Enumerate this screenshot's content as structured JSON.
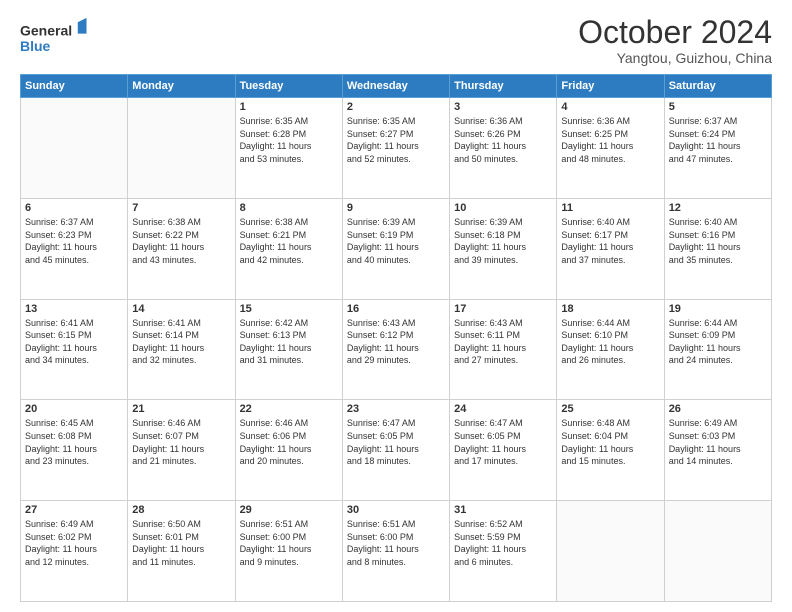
{
  "header": {
    "logo_line1": "General",
    "logo_line2": "Blue",
    "month": "October 2024",
    "location": "Yangtou, Guizhou, China"
  },
  "weekdays": [
    "Sunday",
    "Monday",
    "Tuesday",
    "Wednesday",
    "Thursday",
    "Friday",
    "Saturday"
  ],
  "weeks": [
    [
      {
        "day": "",
        "info": ""
      },
      {
        "day": "",
        "info": ""
      },
      {
        "day": "1",
        "info": "Sunrise: 6:35 AM\nSunset: 6:28 PM\nDaylight: 11 hours\nand 53 minutes."
      },
      {
        "day": "2",
        "info": "Sunrise: 6:35 AM\nSunset: 6:27 PM\nDaylight: 11 hours\nand 52 minutes."
      },
      {
        "day": "3",
        "info": "Sunrise: 6:36 AM\nSunset: 6:26 PM\nDaylight: 11 hours\nand 50 minutes."
      },
      {
        "day": "4",
        "info": "Sunrise: 6:36 AM\nSunset: 6:25 PM\nDaylight: 11 hours\nand 48 minutes."
      },
      {
        "day": "5",
        "info": "Sunrise: 6:37 AM\nSunset: 6:24 PM\nDaylight: 11 hours\nand 47 minutes."
      }
    ],
    [
      {
        "day": "6",
        "info": "Sunrise: 6:37 AM\nSunset: 6:23 PM\nDaylight: 11 hours\nand 45 minutes."
      },
      {
        "day": "7",
        "info": "Sunrise: 6:38 AM\nSunset: 6:22 PM\nDaylight: 11 hours\nand 43 minutes."
      },
      {
        "day": "8",
        "info": "Sunrise: 6:38 AM\nSunset: 6:21 PM\nDaylight: 11 hours\nand 42 minutes."
      },
      {
        "day": "9",
        "info": "Sunrise: 6:39 AM\nSunset: 6:19 PM\nDaylight: 11 hours\nand 40 minutes."
      },
      {
        "day": "10",
        "info": "Sunrise: 6:39 AM\nSunset: 6:18 PM\nDaylight: 11 hours\nand 39 minutes."
      },
      {
        "day": "11",
        "info": "Sunrise: 6:40 AM\nSunset: 6:17 PM\nDaylight: 11 hours\nand 37 minutes."
      },
      {
        "day": "12",
        "info": "Sunrise: 6:40 AM\nSunset: 6:16 PM\nDaylight: 11 hours\nand 35 minutes."
      }
    ],
    [
      {
        "day": "13",
        "info": "Sunrise: 6:41 AM\nSunset: 6:15 PM\nDaylight: 11 hours\nand 34 minutes."
      },
      {
        "day": "14",
        "info": "Sunrise: 6:41 AM\nSunset: 6:14 PM\nDaylight: 11 hours\nand 32 minutes."
      },
      {
        "day": "15",
        "info": "Sunrise: 6:42 AM\nSunset: 6:13 PM\nDaylight: 11 hours\nand 31 minutes."
      },
      {
        "day": "16",
        "info": "Sunrise: 6:43 AM\nSunset: 6:12 PM\nDaylight: 11 hours\nand 29 minutes."
      },
      {
        "day": "17",
        "info": "Sunrise: 6:43 AM\nSunset: 6:11 PM\nDaylight: 11 hours\nand 27 minutes."
      },
      {
        "day": "18",
        "info": "Sunrise: 6:44 AM\nSunset: 6:10 PM\nDaylight: 11 hours\nand 26 minutes."
      },
      {
        "day": "19",
        "info": "Sunrise: 6:44 AM\nSunset: 6:09 PM\nDaylight: 11 hours\nand 24 minutes."
      }
    ],
    [
      {
        "day": "20",
        "info": "Sunrise: 6:45 AM\nSunset: 6:08 PM\nDaylight: 11 hours\nand 23 minutes."
      },
      {
        "day": "21",
        "info": "Sunrise: 6:46 AM\nSunset: 6:07 PM\nDaylight: 11 hours\nand 21 minutes."
      },
      {
        "day": "22",
        "info": "Sunrise: 6:46 AM\nSunset: 6:06 PM\nDaylight: 11 hours\nand 20 minutes."
      },
      {
        "day": "23",
        "info": "Sunrise: 6:47 AM\nSunset: 6:05 PM\nDaylight: 11 hours\nand 18 minutes."
      },
      {
        "day": "24",
        "info": "Sunrise: 6:47 AM\nSunset: 6:05 PM\nDaylight: 11 hours\nand 17 minutes."
      },
      {
        "day": "25",
        "info": "Sunrise: 6:48 AM\nSunset: 6:04 PM\nDaylight: 11 hours\nand 15 minutes."
      },
      {
        "day": "26",
        "info": "Sunrise: 6:49 AM\nSunset: 6:03 PM\nDaylight: 11 hours\nand 14 minutes."
      }
    ],
    [
      {
        "day": "27",
        "info": "Sunrise: 6:49 AM\nSunset: 6:02 PM\nDaylight: 11 hours\nand 12 minutes."
      },
      {
        "day": "28",
        "info": "Sunrise: 6:50 AM\nSunset: 6:01 PM\nDaylight: 11 hours\nand 11 minutes."
      },
      {
        "day": "29",
        "info": "Sunrise: 6:51 AM\nSunset: 6:00 PM\nDaylight: 11 hours\nand 9 minutes."
      },
      {
        "day": "30",
        "info": "Sunrise: 6:51 AM\nSunset: 6:00 PM\nDaylight: 11 hours\nand 8 minutes."
      },
      {
        "day": "31",
        "info": "Sunrise: 6:52 AM\nSunset: 5:59 PM\nDaylight: 11 hours\nand 6 minutes."
      },
      {
        "day": "",
        "info": ""
      },
      {
        "day": "",
        "info": ""
      }
    ]
  ]
}
